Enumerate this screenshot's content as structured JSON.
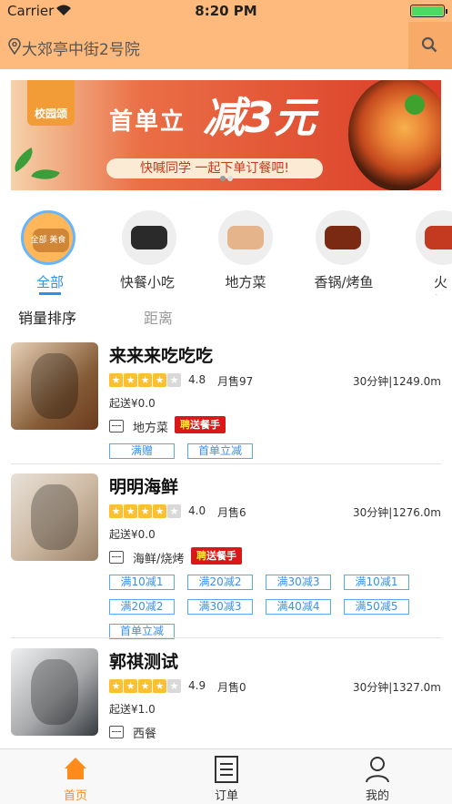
{
  "status": {
    "carrier": "Carrier",
    "time": "8:20 PM"
  },
  "header": {
    "address": "大郊亭中街2号院"
  },
  "banner": {
    "badge": "校园颂",
    "head": "首单立",
    "big_text": "减3元",
    "subtitle": "快喊同学 一起下单订餐吧!"
  },
  "categories": [
    {
      "label": "全部",
      "icon_text": "全部 美食"
    },
    {
      "label": "快餐小吃"
    },
    {
      "label": "地方菜"
    },
    {
      "label": "香锅/烤鱼"
    },
    {
      "label": "火锅"
    }
  ],
  "sort": {
    "by_sales": "销量排序",
    "by_distance": "距离"
  },
  "shops": [
    {
      "name": "来来来吃吃吃",
      "rating": "4.8",
      "sold": "月售97",
      "distance": "30分钟|1249.0m",
      "min_order": "起送¥0.0",
      "category": "地方菜",
      "tags": [
        "满赠",
        "首单立减"
      ]
    },
    {
      "name": "明明海鲜",
      "rating": "4.0",
      "sold": "月售6",
      "distance": "30分钟|1276.0m",
      "min_order": "起送¥0.0",
      "category": "海鲜/烧烤",
      "tags": [
        "满10减1",
        "满20减2",
        "满30减3",
        "满10减1",
        "满20减2",
        "满30减3",
        "满40减4",
        "满50减5",
        "首单立减"
      ]
    },
    {
      "name": "郭祺测试",
      "rating": "4.9",
      "sold": "月售0",
      "distance": "30分钟|1327.0m",
      "min_order": "起送¥1.0",
      "category": "西餐",
      "tags": []
    }
  ],
  "recruit": {
    "pin": "聘",
    "text": "送餐手"
  },
  "tabbar": {
    "home": "首页",
    "orders": "订单",
    "mine": "我的"
  },
  "colors": {
    "header": "#fdba7c",
    "accent_blue": "#2f8fe8",
    "accent_orange": "#ff8c1a",
    "recruit_red": "#d91818"
  }
}
